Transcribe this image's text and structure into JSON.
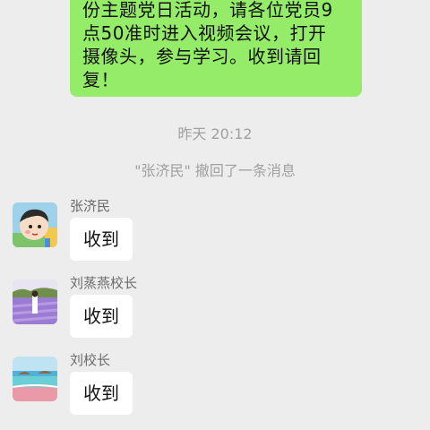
{
  "outgoing_message": {
    "lines": [
      "份主题党日活动，请各位党员9",
      "点50准时进入视频会议，打开",
      "摄像头，参与学习。收到请回",
      "复！"
    ]
  },
  "timestamp": "昨天 20:12",
  "system_notice": "\"张济民\" 撤回了一条消息",
  "messages": [
    {
      "sender": "张济民",
      "text": "收到",
      "avatar_icon": "cartoon-boy-avatar"
    },
    {
      "sender": "刘蒸燕校长",
      "text": "收到",
      "avatar_icon": "lavender-field-avatar"
    },
    {
      "sender": "刘校长",
      "text": "收到",
      "avatar_icon": "beach-avatar"
    }
  ],
  "colors": {
    "background": "#ededed",
    "outgoing_bubble": "#95ec69",
    "incoming_bubble": "#ffffff",
    "meta_text": "#a0a0a0"
  }
}
